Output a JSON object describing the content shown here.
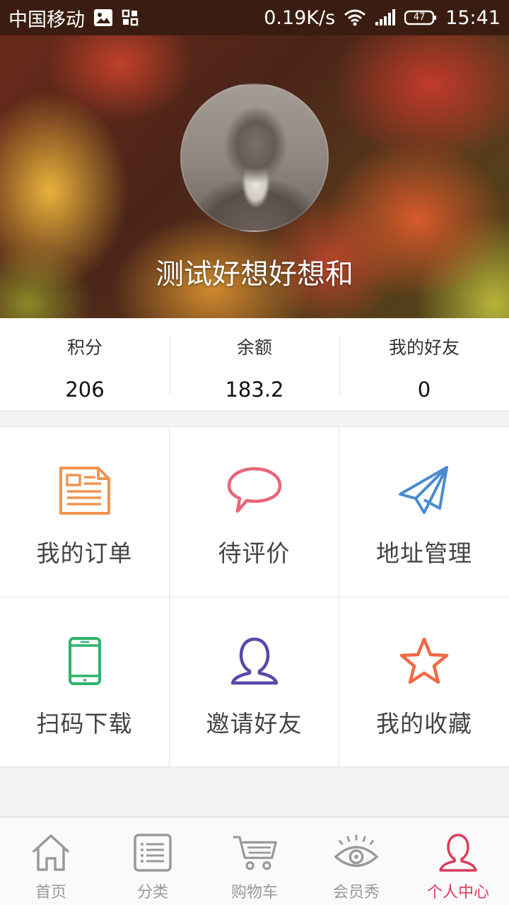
{
  "status_bar": {
    "carrier": "中国移动",
    "speed": "0.19K/s",
    "battery": "47",
    "time": "15:41"
  },
  "profile": {
    "name": "测试好想好想和"
  },
  "stats": [
    {
      "label": "积分",
      "value": "206"
    },
    {
      "label": "余额",
      "value": "183.2"
    },
    {
      "label": "我的好友",
      "value": "0"
    }
  ],
  "menu": [
    {
      "label": "我的订单",
      "icon": "order-document-icon",
      "color": "#f0944f"
    },
    {
      "label": "待评价",
      "icon": "speech-bubble-icon",
      "color": "#e8657a"
    },
    {
      "label": "地址管理",
      "icon": "paper-plane-icon",
      "color": "#4a8bd0"
    },
    {
      "label": "扫码下载",
      "icon": "phone-icon",
      "color": "#2db46a"
    },
    {
      "label": "邀请好友",
      "icon": "user-icon",
      "color": "#5a48a8"
    },
    {
      "label": "我的收藏",
      "icon": "star-icon",
      "color": "#f06a45"
    }
  ],
  "bottom_nav": [
    {
      "label": "首页",
      "icon": "home-icon",
      "active": false
    },
    {
      "label": "分类",
      "icon": "list-icon",
      "active": false
    },
    {
      "label": "购物车",
      "icon": "cart-icon",
      "active": false
    },
    {
      "label": "会员秀",
      "icon": "eye-icon",
      "active": false
    },
    {
      "label": "个人中心",
      "icon": "person-icon",
      "active": true
    }
  ],
  "colors": {
    "accent": "#e03a5a",
    "status_bar_bg": "#3a1d10",
    "inactive_nav": "#999999"
  }
}
